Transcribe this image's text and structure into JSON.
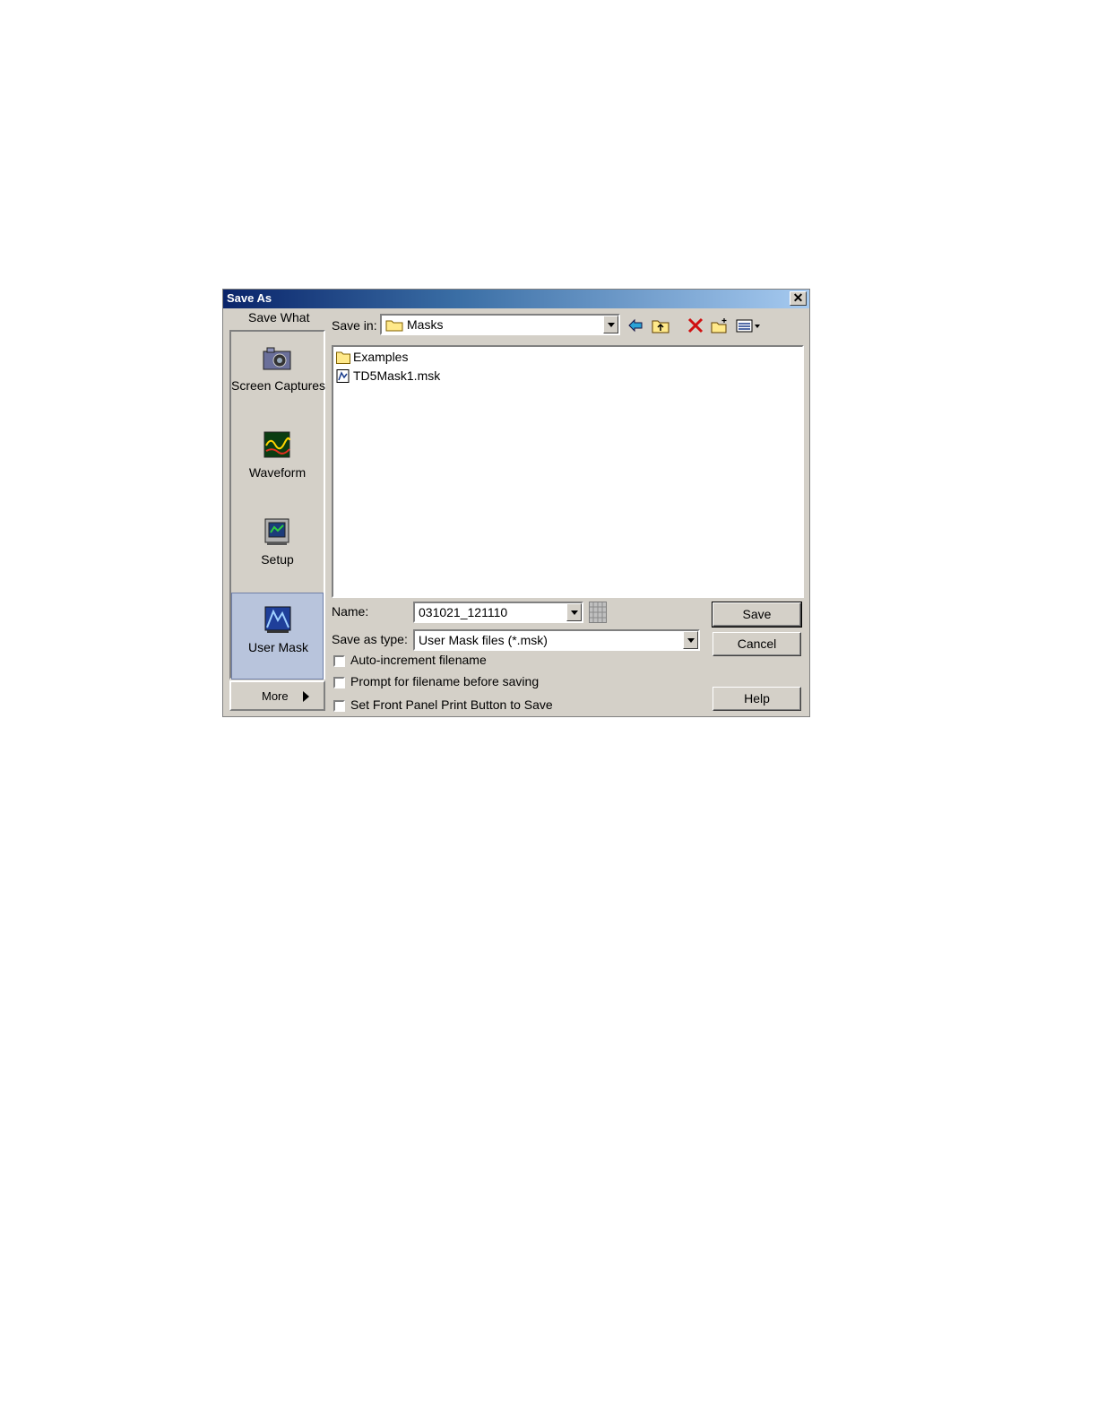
{
  "dialog": {
    "title": "Save As",
    "close_glyph": "✕",
    "save_what_label": "Save What",
    "save_in_label": "Save in:",
    "save_in_value": "Masks",
    "sidebar": {
      "items": [
        {
          "label": "Screen Captures",
          "icon": "camera-icon"
        },
        {
          "label": "Waveform",
          "icon": "waveform-icon"
        },
        {
          "label": "Setup",
          "icon": "setup-icon"
        },
        {
          "label": "User Mask",
          "icon": "user-mask-icon",
          "selected": true
        }
      ],
      "more_label": "More"
    },
    "toolbar_icons": [
      "back-icon",
      "up-folder-icon",
      "delete-icon",
      "new-folder-icon",
      "view-menu-icon"
    ],
    "files": [
      {
        "name": "Examples",
        "type": "folder"
      },
      {
        "name": "TD5Mask1.msk",
        "type": "mask-file"
      }
    ],
    "name_label": "Name:",
    "name_value": "031021_121110",
    "type_label": "Save as type:",
    "type_value": "User Mask files (*.msk)",
    "checkboxes": [
      {
        "label": "Auto-increment filename",
        "checked": false
      },
      {
        "label": "Prompt for filename before saving",
        "checked": false
      },
      {
        "label": "Set Front Panel Print Button to Save",
        "checked": false
      }
    ],
    "buttons": {
      "save": "Save",
      "cancel": "Cancel",
      "help": "Help"
    },
    "colors": {
      "title_start": "#0a246a",
      "title_end": "#a6caf0",
      "face": "#d4d0c8",
      "selected": "#b8c4dc"
    }
  }
}
